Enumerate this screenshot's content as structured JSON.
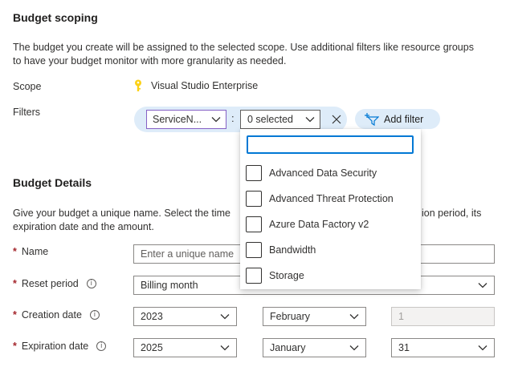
{
  "scoping": {
    "title": "Budget scoping",
    "description_line1": "The budget you create will be assigned to the selected scope. Use additional filters like resource groups",
    "description_line2": "to have your budget monitor with more granularity as needed.",
    "scope_label": "Scope",
    "scope_value": "Visual Studio Enterprise",
    "filters_label": "Filters",
    "filter_field": "ServiceN...",
    "filter_colon": ":",
    "filter_value": "0 selected",
    "add_filter_label": "Add filter"
  },
  "dropdown": {
    "search_value": "",
    "options": [
      "Advanced Data Security",
      "Advanced Threat Protection",
      "Azure Data Factory v2",
      "Bandwidth",
      "Storage"
    ]
  },
  "details": {
    "title": "Budget Details",
    "description_line1_left": "Give your budget a unique name. Select the time",
    "description_line1_right": "ion period, its",
    "description_line2": "expiration date and the amount.",
    "name_label": "Name",
    "name_placeholder": "Enter a unique name",
    "reset_label": "Reset period",
    "reset_value": "Billing month",
    "creation_label": "Creation date",
    "creation_year": "2023",
    "creation_month": "February",
    "creation_day": "1",
    "expiration_label": "Expiration date",
    "expiration_year": "2025",
    "expiration_month": "January",
    "expiration_day": "31",
    "required_mark": "*",
    "info_glyph": "i"
  },
  "colors": {
    "accent": "#0078d4",
    "pill_bg": "#deecf9",
    "required": "#a4262c",
    "filter_border": "#8661c5",
    "key_icon": "#fcd116"
  },
  "icons": [
    "key-icon",
    "chevron-down-icon",
    "close-icon",
    "add-filter-icon",
    "info-icon"
  ]
}
